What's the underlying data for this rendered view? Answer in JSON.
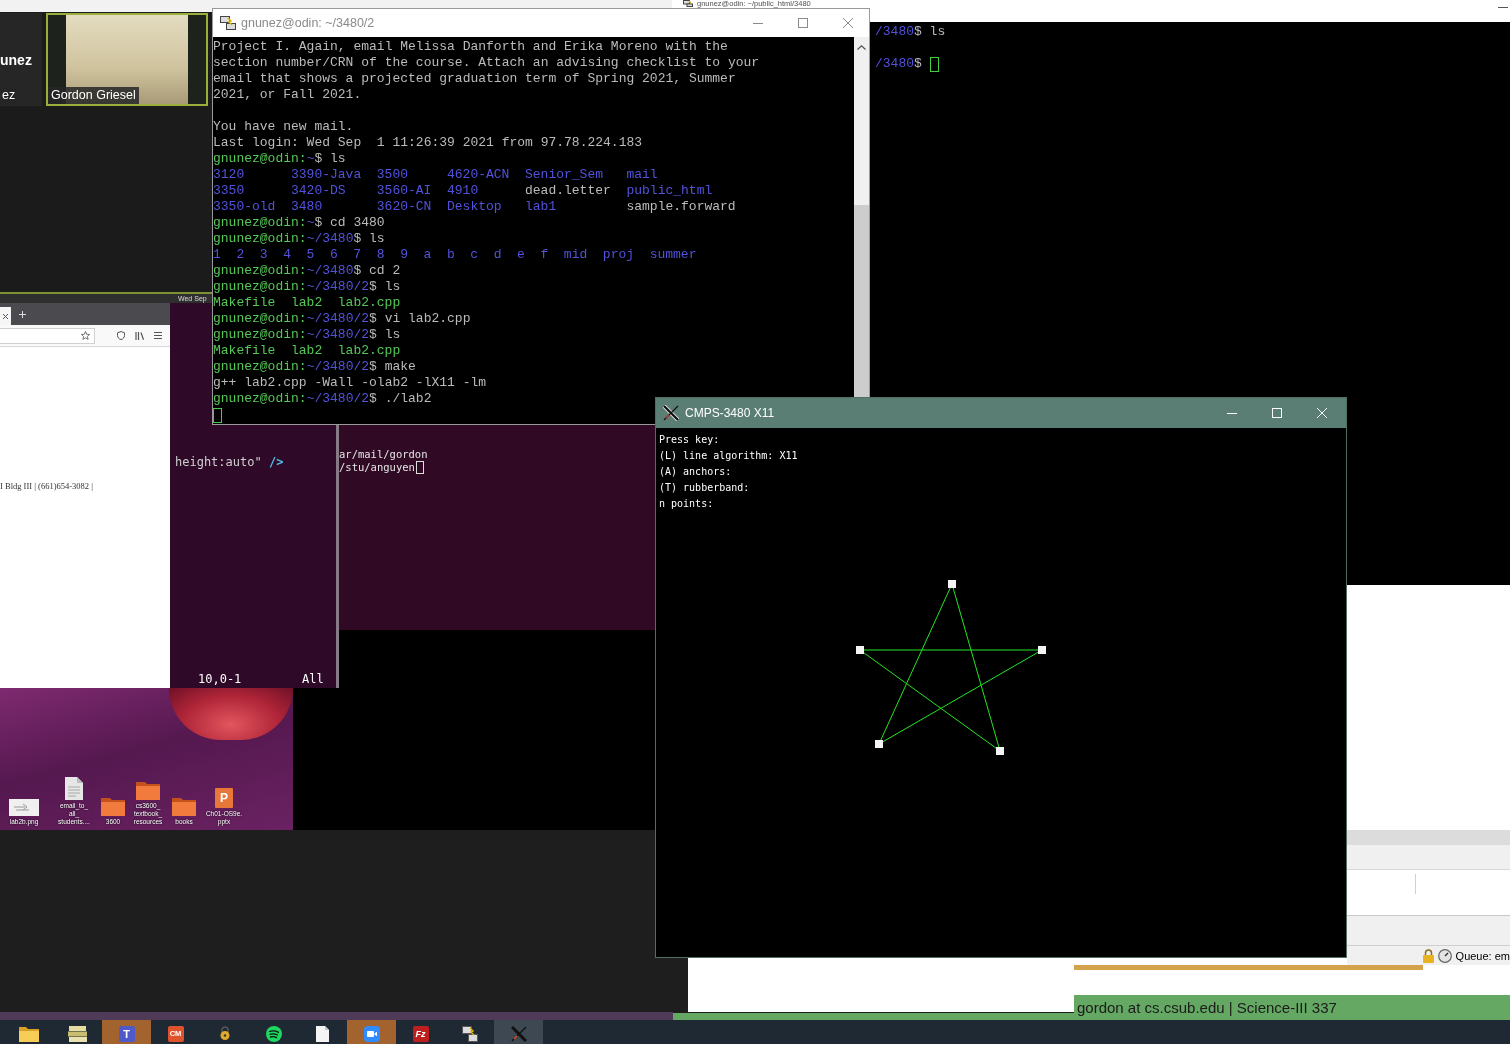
{
  "zoom_gallery": {
    "tiles": [
      {
        "kind": "name",
        "name": "unez",
        "label": "ez",
        "speaking": false
      },
      {
        "kind": "video",
        "label": "Gordon Griesel",
        "speaking": true
      }
    ]
  },
  "shared_screen": {
    "top_bar": {
      "clock": "Wed Sep"
    },
    "browser": {
      "page_text": "I Bldg III | (661)654-3082 |"
    },
    "vim": {
      "code_text": "height:auto\"",
      "code_tag": "/>",
      "cursor_position": "10,0-1",
      "scroll_position": "All"
    },
    "terminal": {
      "lines": [
        {
          "text": "ar/mail/gordon",
          "cursor": false
        },
        {
          "text": "/stu/anguyen",
          "cursor": true
        }
      ]
    },
    "desktop_icons": [
      {
        "kind": "image",
        "label_lines": [
          "lab2b.png"
        ]
      },
      {
        "kind": "document",
        "label_lines": [
          "email_to_",
          "all_",
          "students...."
        ]
      },
      {
        "kind": "folder",
        "label_lines": [
          "3600"
        ]
      },
      {
        "kind": "folder",
        "label_lines": [
          "cs3600_",
          "textbook_",
          "resources"
        ]
      },
      {
        "kind": "folder",
        "label_lines": [
          "books"
        ]
      },
      {
        "kind": "slides",
        "glyph": "P",
        "label_lines": [
          "Ch01-OS9e.",
          "pptx"
        ]
      }
    ]
  },
  "back_terminal": {
    "title": "gnunez@odin: ~/public_html/3480",
    "lines": [
      {
        "kind": "prompt",
        "path": "/3480",
        "command": "$ ls"
      },
      {
        "kind": "blank"
      },
      {
        "kind": "input",
        "path": "/3480",
        "command": "$"
      }
    ]
  },
  "putty": {
    "title": "gnunez@odin: ~/3480/2",
    "lines": [
      {
        "kind": "text",
        "text": "Project I. Again, email Melissa Danforth and Erika Moreno with the"
      },
      {
        "kind": "text",
        "text": "section number/CRN of the course. Attach an advising checklist to your"
      },
      {
        "kind": "text",
        "text": "email that shows a projected graduation term of Spring 2021, Summer"
      },
      {
        "kind": "text",
        "text": "2021, or Fall 2021."
      },
      {
        "kind": "blank"
      },
      {
        "kind": "text",
        "text": "You have new mail."
      },
      {
        "kind": "text",
        "text": "Last login: Wed Sep  1 11:26:39 2021 from 97.78.224.183"
      },
      {
        "kind": "prompt",
        "user": "gnunez@odin:",
        "path": "~",
        "command": "$ ls"
      },
      {
        "kind": "listing",
        "rows": [
          [
            {
              "name": "3120",
              "kind": "dir"
            },
            {
              "name": "3390-Java",
              "kind": "dir"
            },
            {
              "name": "3500",
              "kind": "dir"
            },
            {
              "name": "4620-ACN",
              "kind": "dir"
            },
            {
              "name": "Senior_Sem",
              "kind": "dir"
            },
            {
              "name": "mail",
              "kind": "dir"
            }
          ],
          [
            {
              "name": "3350",
              "kind": "dir"
            },
            {
              "name": "3420-DS",
              "kind": "dir"
            },
            {
              "name": "3560-AI",
              "kind": "dir"
            },
            {
              "name": "4910",
              "kind": "dir"
            },
            {
              "name": "dead.letter",
              "kind": "file"
            },
            {
              "name": "public_html",
              "kind": "dir"
            }
          ],
          [
            {
              "name": "3350-old",
              "kind": "dir"
            },
            {
              "name": "3480",
              "kind": "dir"
            },
            {
              "name": "3620-CN",
              "kind": "dir"
            },
            {
              "name": "Desktop",
              "kind": "dir"
            },
            {
              "name": "lab1",
              "kind": "dir"
            },
            {
              "name": "sample.forward",
              "kind": "file"
            }
          ]
        ]
      },
      {
        "kind": "prompt",
        "user": "gnunez@odin:",
        "path": "~",
        "command": "$ cd 3480"
      },
      {
        "kind": "prompt",
        "user": "gnunez@odin:",
        "path": "~/3480",
        "command": "$ ls"
      },
      {
        "kind": "listing",
        "rows": [
          [
            {
              "name": "1",
              "kind": "dir"
            },
            {
              "name": "2",
              "kind": "dir"
            },
            {
              "name": "3",
              "kind": "dir"
            },
            {
              "name": "4",
              "kind": "dir"
            },
            {
              "name": "5",
              "kind": "dir"
            },
            {
              "name": "6",
              "kind": "dir"
            },
            {
              "name": "7",
              "kind": "dir"
            },
            {
              "name": "8",
              "kind": "dir"
            },
            {
              "name": "9",
              "kind": "dir"
            },
            {
              "name": "a",
              "kind": "dir"
            },
            {
              "name": "b",
              "kind": "dir"
            },
            {
              "name": "c",
              "kind": "dir"
            },
            {
              "name": "d",
              "kind": "dir"
            },
            {
              "name": "e",
              "kind": "dir"
            },
            {
              "name": "f",
              "kind": "dir"
            },
            {
              "name": "mid",
              "kind": "dir"
            },
            {
              "name": "proj",
              "kind": "dir"
            },
            {
              "name": "summer",
              "kind": "dir"
            }
          ]
        ]
      },
      {
        "kind": "prompt",
        "user": "gnunez@odin:",
        "path": "~/3480",
        "command": "$ cd 2"
      },
      {
        "kind": "prompt",
        "user": "gnunez@odin:",
        "path": "~/3480/2",
        "command": "$ ls"
      },
      {
        "kind": "listing",
        "rows": [
          [
            {
              "name": "Makefile",
              "kind": "exec"
            },
            {
              "name": "lab2",
              "kind": "exec"
            },
            {
              "name": "lab2.cpp",
              "kind": "exec"
            }
          ]
        ]
      },
      {
        "kind": "prompt",
        "user": "gnunez@odin:",
        "path": "~/3480/2",
        "command": "$ vi lab2.cpp"
      },
      {
        "kind": "prompt",
        "user": "gnunez@odin:",
        "path": "~/3480/2",
        "command": "$ ls"
      },
      {
        "kind": "listing",
        "rows": [
          [
            {
              "name": "Makefile",
              "kind": "exec"
            },
            {
              "name": "lab2",
              "kind": "exec"
            },
            {
              "name": "lab2.cpp",
              "kind": "exec"
            }
          ]
        ]
      },
      {
        "kind": "prompt",
        "user": "gnunez@odin:",
        "path": "~/3480/2",
        "command": "$ make"
      },
      {
        "kind": "text",
        "text": "g++ lab2.cpp -Wall -olab2 -lX11 -lm"
      },
      {
        "kind": "prompt",
        "user": "gnunez@odin:",
        "path": "~/3480/2",
        "command": "$ ./lab2"
      },
      {
        "kind": "cursor"
      }
    ]
  },
  "x11_window": {
    "title": "CMPS-3480 X11",
    "text_lines": [
      "Press key:",
      "(L) line algorithm: X11",
      "(A) anchors:",
      "(T) rubberband:",
      "n points:"
    ]
  },
  "file_transfer_window": {
    "status": "Queue: em"
  },
  "status_strip": {
    "text": "gordon at cs.csub.edu | Science-III 337"
  },
  "taskbar": {
    "apps": [
      {
        "kind": "folder",
        "flashing": false,
        "active": false
      },
      {
        "kind": "books",
        "flashing": false,
        "active": false
      },
      {
        "kind": "chat",
        "glyph": "T",
        "flashing": true,
        "active": false
      },
      {
        "kind": "tile",
        "glyph": "CM",
        "flashing": false,
        "active": false
      },
      {
        "kind": "lock",
        "flashing": false,
        "active": false
      },
      {
        "kind": "music",
        "flashing": false,
        "active": false
      },
      {
        "kind": "page",
        "flashing": false,
        "active": false
      },
      {
        "kind": "video",
        "flashing": true,
        "active": false
      },
      {
        "kind": "transfer",
        "glyph": "Fz",
        "flashing": false,
        "active": false
      },
      {
        "kind": "network",
        "flashing": false,
        "active": false
      },
      {
        "kind": "x_logo",
        "flashing": false,
        "active": true
      }
    ]
  }
}
